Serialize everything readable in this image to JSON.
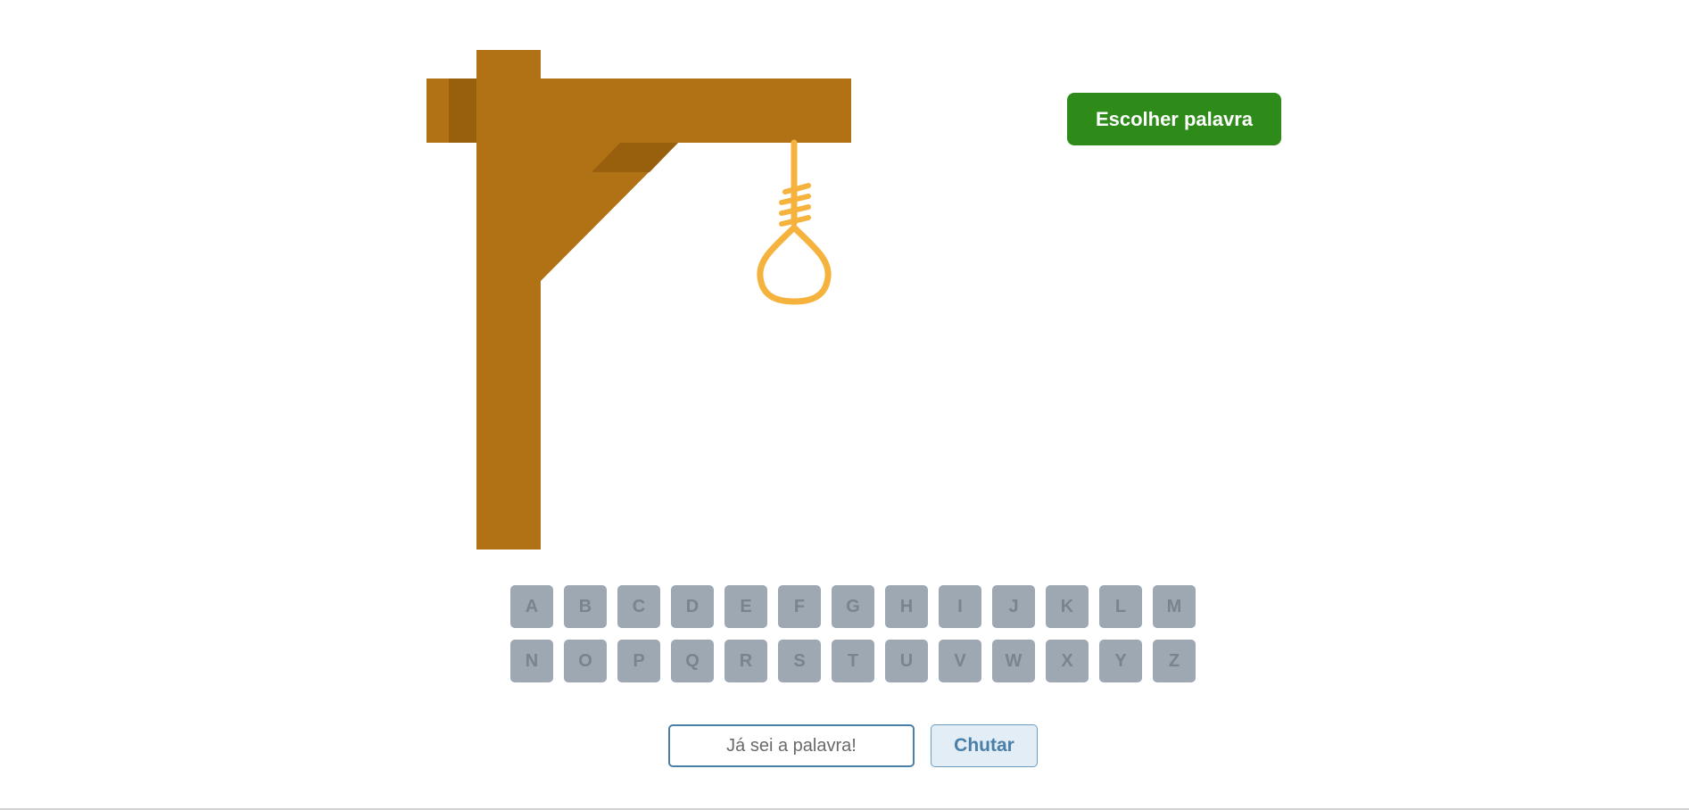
{
  "game": {
    "choose_word_label": "Escolher palavra",
    "guess_placeholder": "Já sei a palavra!",
    "guess_button_label": "Chutar"
  },
  "keyboard": {
    "row1": [
      "A",
      "B",
      "C",
      "D",
      "E",
      "F",
      "G",
      "H",
      "I",
      "J",
      "K",
      "L",
      "M"
    ],
    "row2": [
      "N",
      "O",
      "P",
      "Q",
      "R",
      "S",
      "T",
      "U",
      "V",
      "W",
      "X",
      "Y",
      "Z"
    ],
    "disabled": true
  },
  "colors": {
    "wood": "#b07214",
    "wood_dark": "#98600c",
    "rope": "#f5b33e",
    "choose_button": "#2e8b1a",
    "key_disabled": "#9ea8b3",
    "guess_border": "#4a7fa8"
  },
  "icons": {
    "gallows": "gallows-image",
    "noose": "noose-rope"
  }
}
